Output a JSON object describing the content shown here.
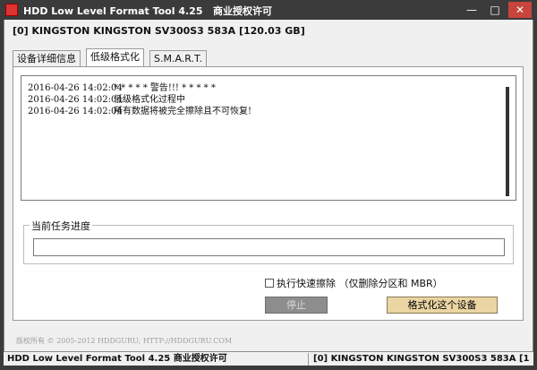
{
  "window": {
    "title": "HDD Low Level Format Tool 4.25",
    "license": "商业授权许可",
    "minimize": "—",
    "maximize": "□",
    "close": "✕"
  },
  "device": {
    "header": "[0]  KINGSTON KINGSTON SV300S3    583A   [120.03 GB]"
  },
  "tabs": [
    {
      "label": "设备详细信息",
      "active": false
    },
    {
      "label": "低级格式化",
      "active": true
    },
    {
      "label": "S.M.A.R.T.",
      "active": false
    }
  ],
  "log": [
    {
      "time": "2016-04-26 14:02:04",
      "message": "* * * * *  警告!!!  * * * * *"
    },
    {
      "time": "2016-04-26 14:02:04",
      "message": "低级格式化过程中"
    },
    {
      "time": "2016-04-26 14:02:04",
      "message": "所有数据将被完全擦除且不可恢复!"
    }
  ],
  "progress": {
    "label": "当前任务进度",
    "value": 0
  },
  "options": {
    "quick_wipe_label": "执行快速擦除 （仅删除分区和 MBR）",
    "quick_wipe_checked": false
  },
  "buttons": {
    "stop": "停止",
    "format": "格式化这个设备"
  },
  "footer": {
    "copyright": "版权所有 © 2005-2012 HDDGURU; HTTP://HDDGURU.COM"
  },
  "statusbar": {
    "app": "HDD Low Level Format Tool 4.25    商业授权许可",
    "device": "[0]  KINGSTON KINGSTON SV300S3    583A    [120.03"
  },
  "colors": {
    "titlebar": "#3b3b3b",
    "close_button": "#c8443c",
    "format_button": "#ead5a3",
    "stop_button": "#8d8d8d"
  }
}
